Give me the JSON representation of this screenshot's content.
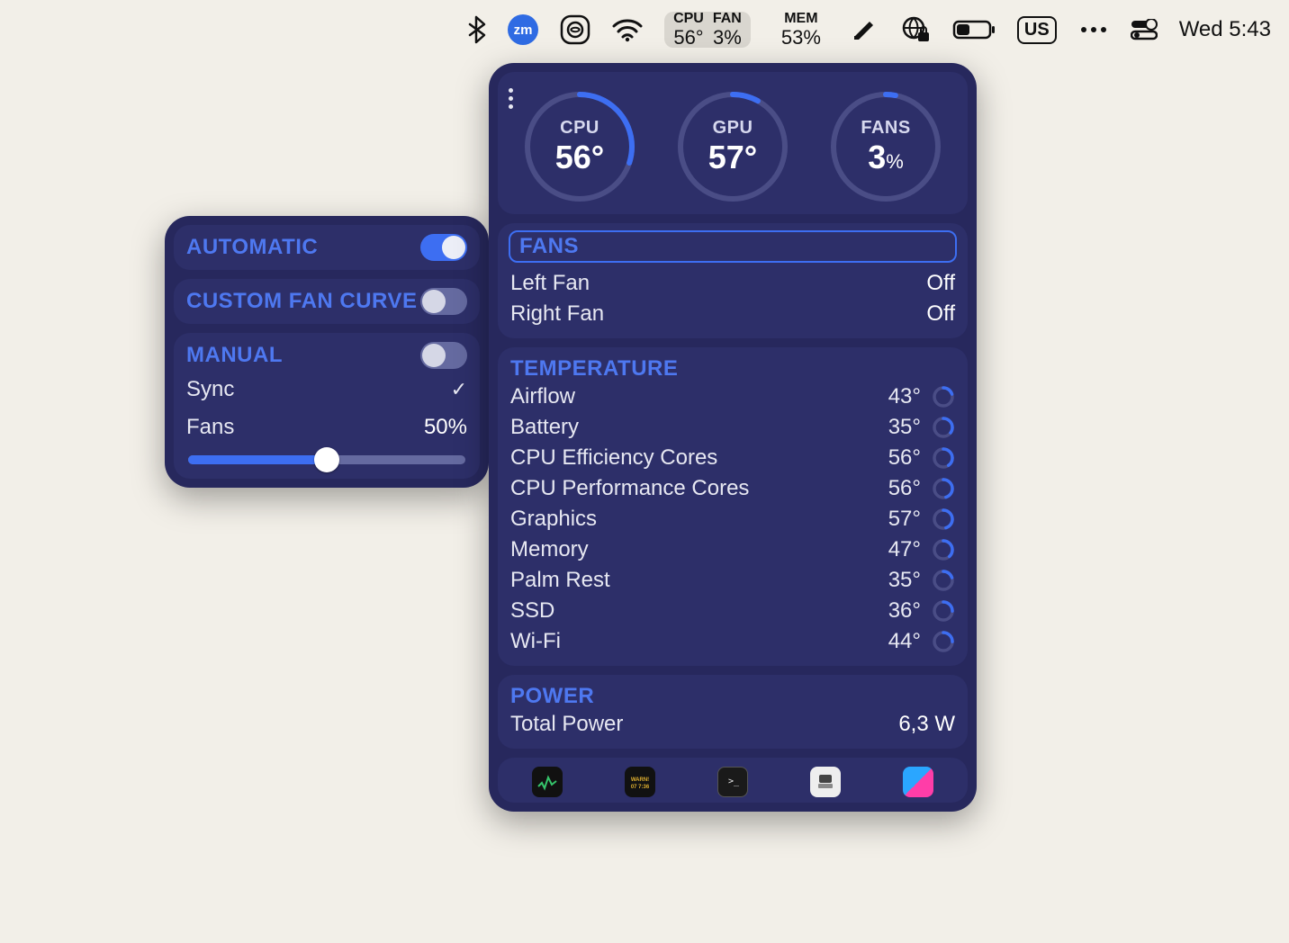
{
  "menubar": {
    "cpu_label": "CPU",
    "cpu_value": "56°",
    "fan_label": "FAN",
    "fan_value": "3%",
    "mem_label": "MEM",
    "mem_value": "53%",
    "input_method": "US",
    "clock": "Wed 5:43"
  },
  "left_panel": {
    "automatic_label": "AUTOMATIC",
    "automatic_on": true,
    "custom_label": "CUSTOM FAN CURVE",
    "custom_on": false,
    "manual_label": "MANUAL",
    "manual_on": false,
    "sync_label": "Sync",
    "sync_checked": true,
    "fans_label": "Fans",
    "fans_value": "50%",
    "fans_percent": 50
  },
  "gauges": {
    "cpu": {
      "label": "CPU",
      "value": "56°",
      "pct": 30
    },
    "gpu": {
      "label": "GPU",
      "value": "57°",
      "pct": 8
    },
    "fans": {
      "label": "FANS",
      "value": "3",
      "suffix": "%",
      "pct": 3
    }
  },
  "fans_section": {
    "header": "FANS",
    "rows": [
      {
        "label": "Left Fan",
        "value": "Off"
      },
      {
        "label": "Right Fan",
        "value": "Off"
      }
    ]
  },
  "temp_section": {
    "header": "TEMPERATURE",
    "rows": [
      {
        "label": "Airflow",
        "value": "43°",
        "pct": 20
      },
      {
        "label": "Battery",
        "value": "35°",
        "pct": 35
      },
      {
        "label": "CPU Efficiency Cores",
        "value": "56°",
        "pct": 40
      },
      {
        "label": "CPU Performance Cores",
        "value": "56°",
        "pct": 45
      },
      {
        "label": "Graphics",
        "value": "57°",
        "pct": 45
      },
      {
        "label": "Memory",
        "value": "47°",
        "pct": 38
      },
      {
        "label": "Palm Rest",
        "value": "35°",
        "pct": 20
      },
      {
        "label": "SSD",
        "value": "36°",
        "pct": 25
      },
      {
        "label": "Wi-Fi",
        "value": "44°",
        "pct": 25
      }
    ]
  },
  "power_section": {
    "header": "POWER",
    "label": "Total Power",
    "value": "6,3 W"
  },
  "accent": "#3d6ef2",
  "ring_track": "#4a4d86"
}
